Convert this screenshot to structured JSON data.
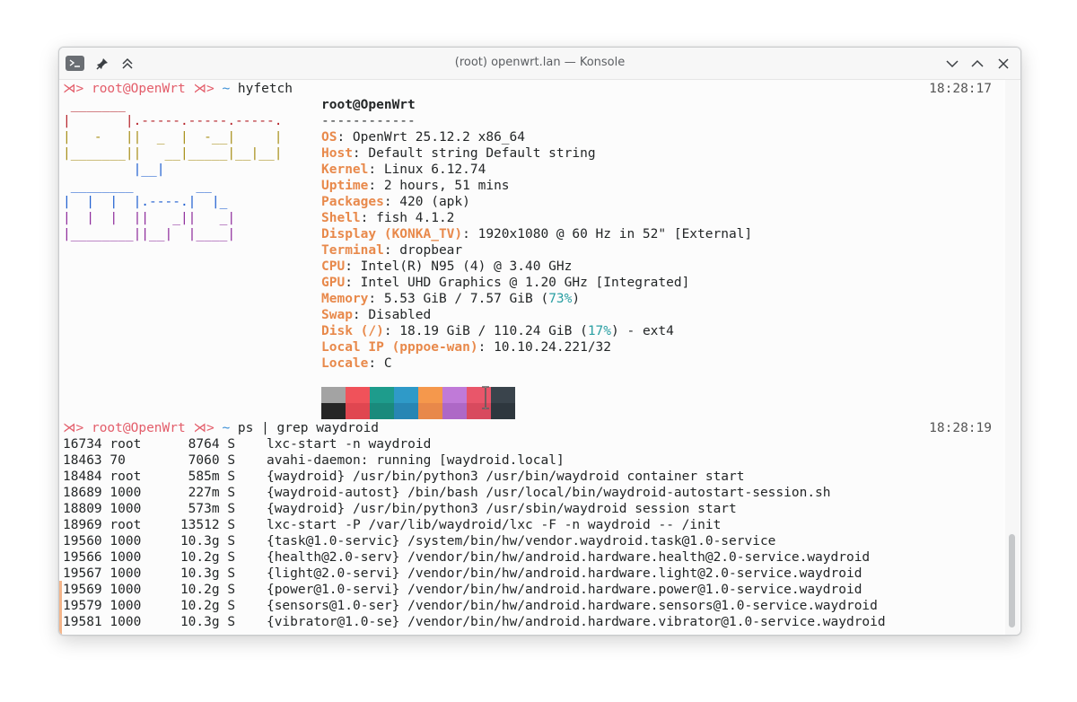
{
  "window": {
    "title": "(root) openwrt.lan — Konsole"
  },
  "colors": {
    "prompt": "#e35d6a",
    "tilde": "#3a8fd6",
    "key": "#e8894b",
    "percent": "#2a9fa3"
  },
  "session1": {
    "prompt_arrows": "⋊>",
    "prompt_user": "root@OpenWrt",
    "prompt_path": "~",
    "command": "hyfetch",
    "time": "18:28:17"
  },
  "logo": {
    "lines": [
      " _______",
      "|       |.-----.-----.-----.",
      "|   -   ||  _  |  -__|     |",
      "|_______||   __|_____|__|__|",
      "         |__|",
      " ________        __",
      "|  |  |  |.----.|  |_",
      "|  |  |  ||   _||   _|",
      "|________||__|  |____|"
    ]
  },
  "fetch": {
    "header": "root@OpenWrt",
    "divider": "------------",
    "rows": [
      {
        "key": "OS",
        "value": ": OpenWrt 25.12.2 x86_64"
      },
      {
        "key": "Host",
        "value": ": Default string Default string"
      },
      {
        "key": "Kernel",
        "value": ": Linux 6.12.74"
      },
      {
        "key": "Uptime",
        "value": ": 2 hours, 51 mins"
      },
      {
        "key": "Packages",
        "value": ": 420 (apk)"
      },
      {
        "key": "Shell",
        "value": ": fish 4.1.2"
      },
      {
        "key": "Display (KONKA_TV)",
        "value": ": 1920x1080 @ 60 Hz in 52\" [External]"
      },
      {
        "key": "Terminal",
        "value": ": dropbear"
      },
      {
        "key": "CPU",
        "value": ": Intel(R) N95 (4) @ 3.40 GHz"
      },
      {
        "key": "GPU",
        "value": ": Intel UHD Graphics @ 1.20 GHz [Integrated]"
      },
      {
        "key": "Memory",
        "value": ": 5.53 GiB / 7.57 GiB (",
        "pct": "73%",
        "tail": ")"
      },
      {
        "key": "Swap",
        "value": ": Disabled"
      },
      {
        "key": "Disk (/)",
        "value": ": 18.19 GiB / 110.24 GiB (",
        "pct": "17%",
        "tail": ") - ext4"
      },
      {
        "key": "Local IP (pppoe-wan)",
        "value": ": 10.10.24.221/32"
      },
      {
        "key": "Locale",
        "value": ": C"
      }
    ],
    "swatches_top": [
      "#a3a3a3",
      "#f0525a",
      "#1e9c8c",
      "#2f9ac8",
      "#f5984c",
      "#c07ad8",
      "#e9566a",
      "#3a444c"
    ],
    "swatches_bottom": [
      "#262626",
      "#e04650",
      "#1a8a7c",
      "#2886b4",
      "#e8884a",
      "#ae68c6",
      "#d84a5e",
      "#2e373e"
    ]
  },
  "session2": {
    "prompt_arrows": "⋊>",
    "prompt_user": "root@OpenWrt",
    "prompt_path": "~",
    "command": "ps | grep waydroid",
    "time": "18:28:19"
  },
  "ps_rows": [
    "16734 root      8764 S    lxc-start -n waydroid",
    "18463 70        7060 S    avahi-daemon: running [waydroid.local]",
    "18484 root      585m S    {waydroid} /usr/bin/python3 /usr/bin/waydroid container start",
    "18689 1000      227m S    {waydroid-autost} /bin/bash /usr/local/bin/waydroid-autostart-session.sh",
    "18809 1000      573m S    {waydroid} /usr/bin/python3 /usr/sbin/waydroid session start",
    "18969 root     13512 S    lxc-start -P /var/lib/waydroid/lxc -F -n waydroid -- /init",
    "19560 1000     10.3g S    {task@1.0-servic} /system/bin/hw/vendor.waydroid.task@1.0-service",
    "19566 1000     10.2g S    {health@2.0-serv} /vendor/bin/hw/android.hardware.health@2.0-service.waydroid",
    "19567 1000     10.3g S    {light@2.0-servi} /vendor/bin/hw/android.hardware.light@2.0-service.waydroid",
    "19569 1000     10.2g S    {power@1.0-servi} /vendor/bin/hw/android.hardware.power@1.0-service.waydroid",
    "19579 1000     10.2g S    {sensors@1.0-ser} /vendor/bin/hw/android.hardware.sensors@1.0-service.waydroid",
    "19581 1000     10.3g S    {vibrator@1.0-se} /vendor/bin/hw/android.hardware.vibrator@1.0-service.waydroid"
  ]
}
